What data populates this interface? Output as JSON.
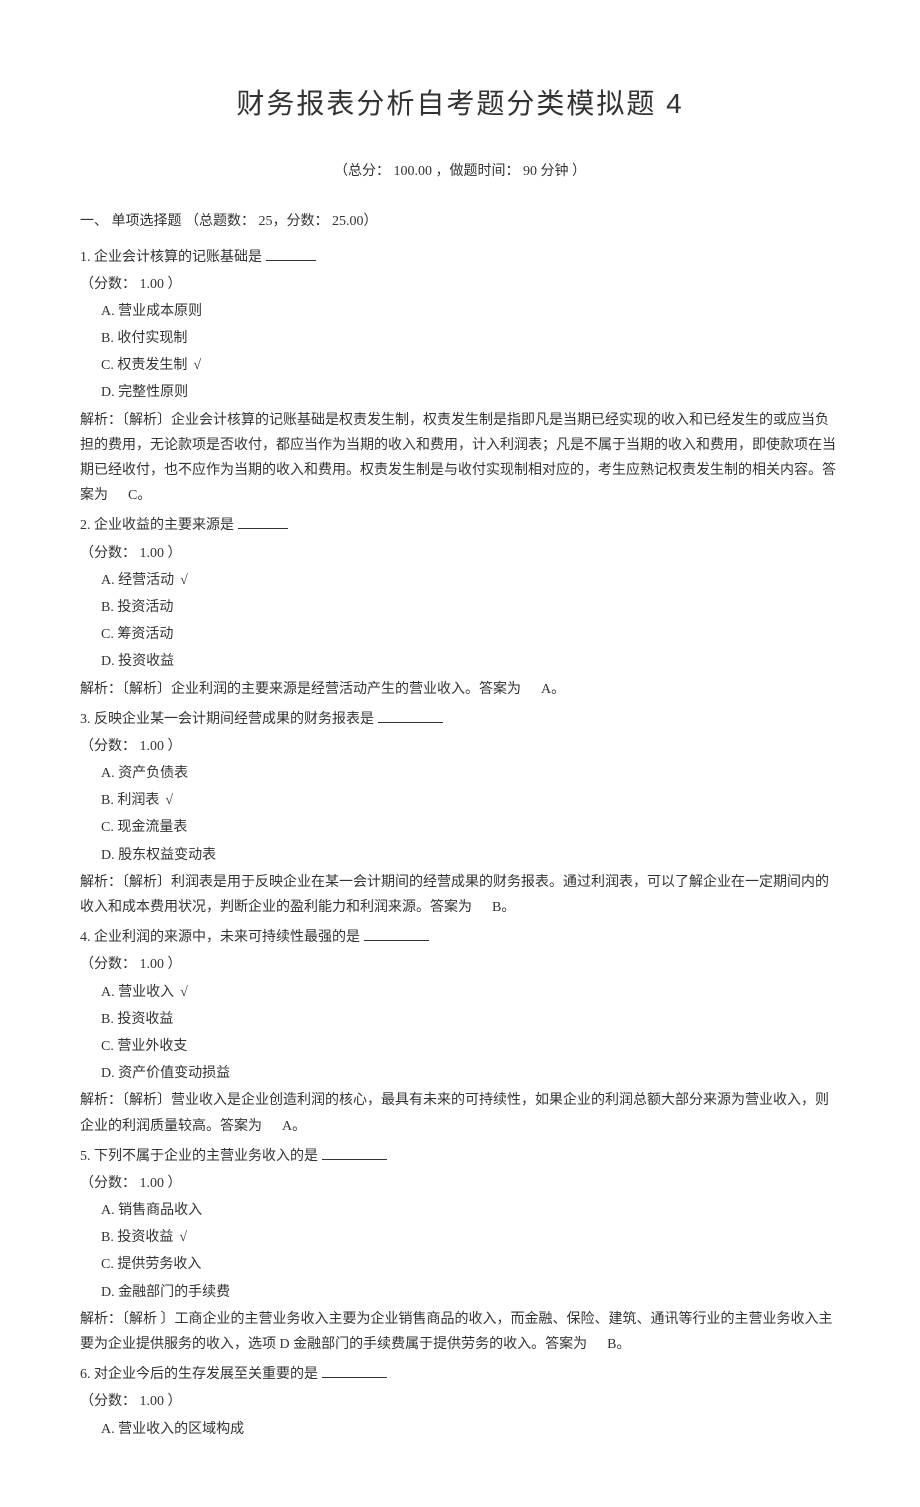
{
  "title": "财务报表分析自考题分类模拟题 4",
  "meta": "（总分： 100.00 ，做题时间： 90 分钟 ）",
  "section": {
    "header": "一、 单项选择题 （总题数： 25，分数： 25.00）"
  },
  "score_label": "（分数： 1.00 ）",
  "questions": [
    {
      "num": "1.",
      "text": "企业会计核算的记账基础是",
      "blank": "short",
      "options": [
        {
          "label": "A.",
          "text": "营业成本原则",
          "correct": false
        },
        {
          "label": "B.",
          "text": "收付实现制",
          "correct": false
        },
        {
          "label": "C.",
          "text": "权责发生制",
          "correct": true
        },
        {
          "label": "D.",
          "text": "完整性原则",
          "correct": false
        }
      ],
      "explanation": "解析：〔解析〕企业会计核算的记账基础是权责发生制，权责发生制是指即凡是当期已经实现的收入和已经发生的或应当负担的费用，无论款项是否收付，都应当作为当期的收入和费用，计入利润表；凡是不属于当期的收入和费用，即使款项在当期已经收付，也不应作为当期的收入和费用。权责发生制是与收付实现制相对应的，考生应熟记权责发生制的相关内容。答案为",
      "answer": "C。"
    },
    {
      "num": "2.",
      "text": "企业收益的主要来源是",
      "blank": "short",
      "options": [
        {
          "label": "A.",
          "text": "经营活动",
          "correct": true
        },
        {
          "label": "B.",
          "text": "投资活动",
          "correct": false
        },
        {
          "label": "C.",
          "text": "筹资活动",
          "correct": false
        },
        {
          "label": "D.",
          "text": "投资收益",
          "correct": false
        }
      ],
      "explanation": "解析：〔解析〕企业利润的主要来源是经营活动产生的营业收入。答案为",
      "answer": "A。"
    },
    {
      "num": "3.",
      "text": "反映企业某一会计期间经营成果的财务报表是",
      "blank": "long",
      "options": [
        {
          "label": "A.",
          "text": "资产负债表",
          "correct": false
        },
        {
          "label": "B.",
          "text": "利润表",
          "correct": true
        },
        {
          "label": "C.",
          "text": "现金流量表",
          "correct": false
        },
        {
          "label": "D.",
          "text": "股东权益变动表",
          "correct": false
        }
      ],
      "explanation": "解析：〔解析〕利润表是用于反映企业在某一会计期间的经营成果的财务报表。通过利润表，可以了解企业在一定期间内的收入和成本费用状况，判断企业的盈利能力和利润来源。答案为",
      "answer": "B。"
    },
    {
      "num": "4.",
      "text": "企业利润的来源中，未来可持续性最强的是",
      "blank": "long",
      "options": [
        {
          "label": "A.",
          "text": "营业收入",
          "correct": true
        },
        {
          "label": "B.",
          "text": "投资收益",
          "correct": false
        },
        {
          "label": "C.",
          "text": "营业外收支",
          "correct": false
        },
        {
          "label": "D.",
          "text": "资产价值变动损益",
          "correct": false
        }
      ],
      "explanation": "解析：〔解析〕营业收入是企业创造利润的核心，最具有未来的可持续性，如果企业的利润总额大部分来源为营业收入，则企业的利润质量较高。答案为",
      "answer": "A。"
    },
    {
      "num": "5.",
      "text": "下列不属于企业的主营业务收入的是",
      "blank": "long",
      "options": [
        {
          "label": "A.",
          "text": "销售商品收入",
          "correct": false
        },
        {
          "label": "B.",
          "text": "投资收益",
          "correct": true
        },
        {
          "label": "C.",
          "text": "提供劳务收入",
          "correct": false
        },
        {
          "label": "D.",
          "text": "金融部门的手续费",
          "correct": false
        }
      ],
      "explanation": "解析：〔解析 〕工商企业的主营业务收入主要为企业销售商品的收入，而金融、保险、建筑、通讯等行业的主营业务收入主要为企业提供服务的收入，选项 D 金融部门的手续费属于提供劳务的收入。答案为",
      "answer": "B。"
    },
    {
      "num": "6.",
      "text": "对企业今后的生存发展至关重要的是",
      "blank": "long",
      "options": [
        {
          "label": "A.",
          "text": "营业收入的区域构成",
          "correct": false
        }
      ],
      "explanation": "",
      "answer": ""
    }
  ],
  "check_mark": "√"
}
